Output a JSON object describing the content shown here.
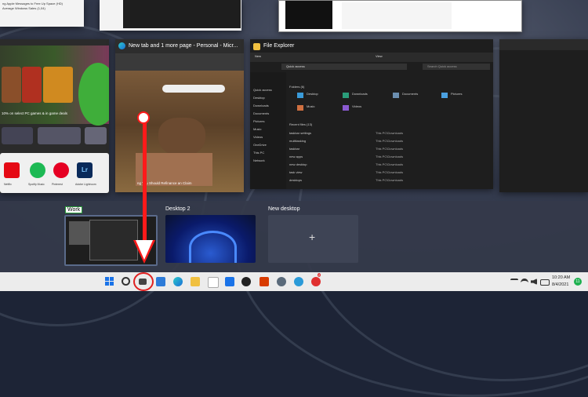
{
  "top_left_window": {
    "lines": [
      "ng Apple Messages to Free Up Space (HD)",
      "Average Windows Sales (1,04)"
    ]
  },
  "windows": {
    "edge": {
      "title": "New tab and 1 more page - Personal - Micr...",
      "caption": "ng You Should Refinance an Claim"
    },
    "file_explorer": {
      "title": "File Explorer",
      "address": "Quick access",
      "search_placeholder": "Search Quick access",
      "toolbar_new": "New",
      "toolbar_view": "View",
      "folders_header": "Folders (6)",
      "folders": [
        {
          "name": "Desktop",
          "sub": "This PC"
        },
        {
          "name": "Downloads",
          "sub": "This PC"
        },
        {
          "name": "Documents",
          "sub": "This PC"
        },
        {
          "name": "Pictures",
          "sub": "This PC"
        },
        {
          "name": "Music",
          "sub": "This PC"
        },
        {
          "name": "Videos",
          "sub": "This PC"
        }
      ],
      "recent_header": "Recent files (13)",
      "recent": [
        {
          "name": "taskbar settings",
          "loc": "This PC\\Downloads"
        },
        {
          "name": "multitasking",
          "loc": "This PC\\Downloads"
        },
        {
          "name": "taskbar",
          "loc": "This PC\\Downloads"
        },
        {
          "name": "new apps",
          "loc": "This PC\\Downloads"
        },
        {
          "name": "new desktop",
          "loc": "This PC\\Downloads"
        },
        {
          "name": "task view",
          "loc": "This PC\\Downloads"
        },
        {
          "name": "desktops",
          "loc": "This PC\\Downloads"
        }
      ],
      "sidebar": [
        "Quick access",
        "Desktop",
        "Downloads",
        "Documents",
        "Pictures",
        "Music",
        "Videos",
        "OneDrive",
        "This PC",
        "Network"
      ]
    },
    "store": {
      "promo": "10% on select PC games & in game deals",
      "apps": [
        "Netflix",
        "Spotify Music",
        "Pinterest",
        "Adobe Lightroom"
      ]
    }
  },
  "desktops": [
    {
      "label": "Work"
    },
    {
      "label": "Desktop 2"
    },
    {
      "label": "New desktop",
      "plus": "+"
    }
  ],
  "taskbar": {
    "time": "10:20 AM",
    "date": "8/4/2021",
    "notification_count": "11",
    "badge": "2",
    "icons": [
      "start-icon",
      "search-icon",
      "task-view-icon",
      "widgets-icon",
      "edge-icon",
      "file-explorer-icon",
      "store-icon",
      "mail-icon",
      "dell-icon",
      "office-icon",
      "settings-icon",
      "globe-icon",
      "app-icon"
    ]
  }
}
